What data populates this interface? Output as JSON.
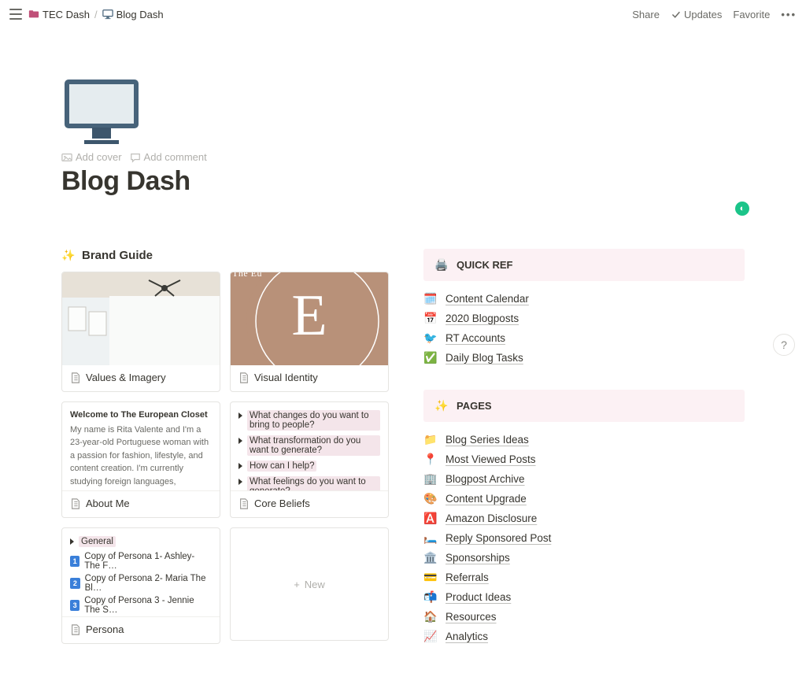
{
  "topbar": {
    "breadcrumb": [
      {
        "icon_color": "#c05078",
        "label": "TEC Dash"
      },
      {
        "icon_color": "#8a8a85",
        "label": "Blog Dash"
      }
    ],
    "share": "Share",
    "updates": "Updates",
    "favorite": "Favorite"
  },
  "page": {
    "add_cover": "Add cover",
    "add_comment": "Add comment",
    "title": "Blog Dash"
  },
  "brand_guide": {
    "heading": "Brand Guide",
    "cards": {
      "values": "Values & Imagery",
      "visual": "Visual Identity",
      "about_title": "Welcome to The European Closet",
      "about_body": "My name is Rita Valente and I'm a 23-year-old Portuguese woman with a passion for fashion, lifestyle, and content creation. I'm currently studying foreign languages, literature, and culture in university (more specifically Spanish and English). I've always had a passion for writing and reading, especially in English so it",
      "about": "About Me",
      "core_q1": "What changes do you want to bring to people?",
      "core_q2": "What transformation do you want to generate?",
      "core_q3": "How can I help?",
      "core_q4": "What feelings do you want to generate?",
      "core": "Core Beliefs",
      "persona_general": "General",
      "persona_1": "Copy of Persona 1- Ashley- The F…",
      "persona_2": "Copy of Persona 2- Maria The Bl…",
      "persona_3": "Copy of Persona 3 - Jennie The S…",
      "persona": "Persona",
      "new": "New"
    }
  },
  "quickref": {
    "heading": "QUICK REF",
    "items": [
      {
        "emoji": "🗓️",
        "label": "Content Calendar",
        "underline": true
      },
      {
        "emoji": "📅",
        "label": "2020 Blogposts",
        "underline": true
      },
      {
        "emoji": "🐦",
        "label": "RT Accounts",
        "underline": true
      },
      {
        "emoji": "✅",
        "label": "Daily Blog Tasks",
        "underline": true
      }
    ]
  },
  "pages": {
    "heading": "PAGES",
    "items": [
      {
        "emoji": "📁",
        "label": "Blog Series Ideas",
        "underline": true
      },
      {
        "emoji": "📍",
        "label": "Most Viewed Posts",
        "underline": true
      },
      {
        "emoji": "🏢",
        "label": "Blogpost Archive",
        "underline": true
      },
      {
        "emoji": "🎨",
        "label": "Content Upgrade",
        "underline": true
      },
      {
        "emoji": "🅰️",
        "label": "Amazon Disclosure",
        "underline": true
      },
      {
        "emoji": "🛏️",
        "label": "Reply Sponsored Post",
        "underline": true
      },
      {
        "emoji": "🏛️",
        "label": "Sponsorships",
        "underline": true
      },
      {
        "emoji": "💳",
        "label": "Referrals",
        "underline": true
      },
      {
        "emoji": "📬",
        "label": "Product Ideas",
        "underline": true
      },
      {
        "emoji": "🏠",
        "label": "Resources",
        "underline": true
      },
      {
        "emoji": "📈",
        "label": "Analytics",
        "underline": true
      }
    ]
  }
}
